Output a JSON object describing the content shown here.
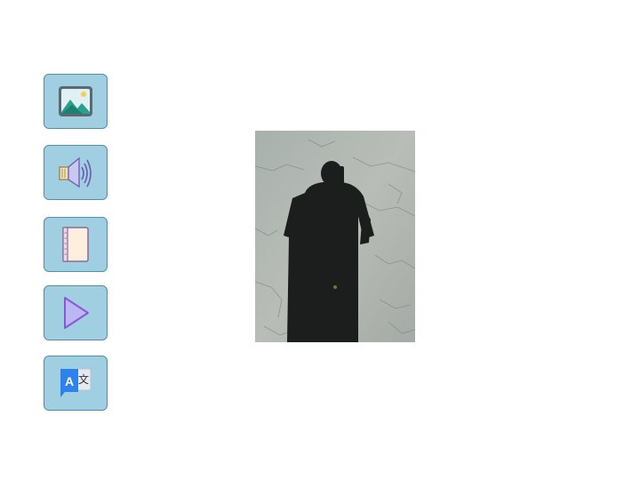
{
  "toolbar": {
    "buttons": [
      {
        "id": "image",
        "icon": "image-icon"
      },
      {
        "id": "audio",
        "icon": "speaker-icon"
      },
      {
        "id": "book",
        "icon": "book-icon"
      },
      {
        "id": "play",
        "icon": "play-icon"
      },
      {
        "id": "translate",
        "icon": "translate-icon",
        "glyph_latin": "A",
        "glyph_cjk": "文"
      }
    ],
    "button_color": "#9fcfe0"
  },
  "main": {
    "photo": {
      "subject": "shadow-photo"
    }
  }
}
